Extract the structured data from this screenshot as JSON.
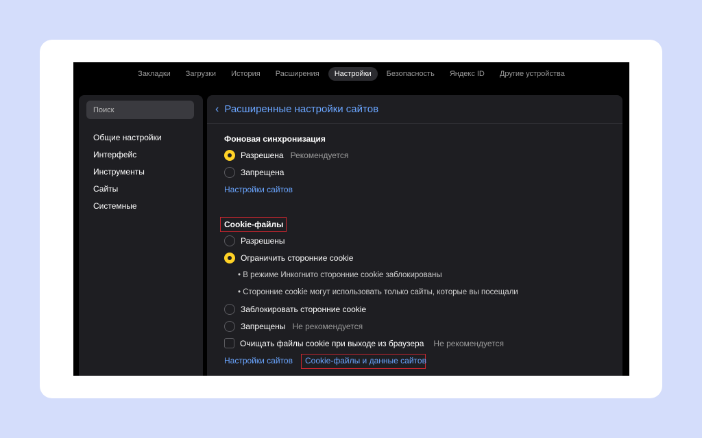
{
  "topnav": {
    "tabs": [
      {
        "label": "Закладки"
      },
      {
        "label": "Загрузки"
      },
      {
        "label": "История"
      },
      {
        "label": "Расширения"
      },
      {
        "label": "Настройки",
        "active": true
      },
      {
        "label": "Безопасность"
      },
      {
        "label": "Яндекс ID"
      },
      {
        "label": "Другие устройства"
      }
    ]
  },
  "sidebar": {
    "search_placeholder": "Поиск",
    "items": [
      {
        "label": "Общие настройки"
      },
      {
        "label": "Интерфейс"
      },
      {
        "label": "Инструменты"
      },
      {
        "label": "Сайты"
      },
      {
        "label": "Системные"
      }
    ]
  },
  "panel": {
    "back_icon": "chevron-left-icon",
    "title": "Расширенные настройки сайтов",
    "background_sync": {
      "title": "Фоновая синхронизация",
      "options": [
        {
          "label": "Разрешена",
          "note": "Рекомендуется",
          "selected": true
        },
        {
          "label": "Запрещена",
          "note": "",
          "selected": false
        }
      ],
      "site_settings_link": "Настройки сайтов"
    },
    "cookies": {
      "title": "Cookie-файлы",
      "options": [
        {
          "label": "Разрешены",
          "note": "",
          "selected": false
        },
        {
          "label": "Ограничить сторонние cookie",
          "note": "",
          "selected": true
        }
      ],
      "bullets": [
        "• В режиме Инкогнито сторонние cookie заблокированы",
        "• Сторонние cookie могут использовать только сайты, которые вы посещали"
      ],
      "options2": [
        {
          "label": "Заблокировать сторонние cookie",
          "note": "",
          "selected": false
        },
        {
          "label": "Запрещены",
          "note": "Не рекомендуется",
          "selected": false
        }
      ],
      "clear_on_exit": {
        "label": "Очищать файлы cookie при выходе из браузера",
        "note": "Не рекомендуется",
        "checked": false
      },
      "site_settings_link": "Настройки сайтов",
      "cookie_data_link": "Cookie-файлы и данные сайтов"
    }
  },
  "colors": {
    "page_bg": "#d4ddfb",
    "panel_bg": "#1e1e22",
    "accent_link": "#6aa5ff",
    "radio_selected": "#ffd226",
    "highlight_box": "#c8262f"
  }
}
